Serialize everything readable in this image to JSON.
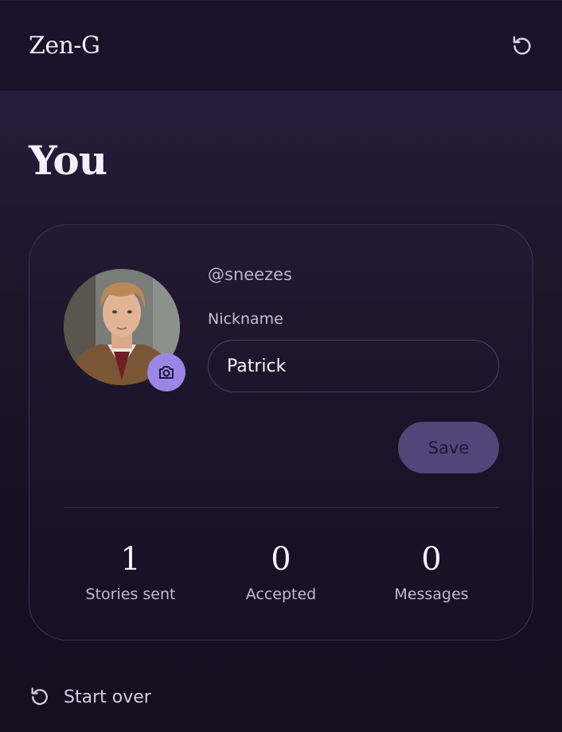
{
  "header": {
    "brand": "Zen-G",
    "refresh_icon": "refresh-icon"
  },
  "page": {
    "title": "You"
  },
  "profile": {
    "avatar_alt": "avatar",
    "camera_icon": "camera-icon",
    "handle": "@sneezes",
    "nickname_label": "Nickname",
    "nickname_value": "Patrick",
    "save_label": "Save"
  },
  "stats": [
    {
      "value": "1",
      "label": "Stories sent"
    },
    {
      "value": "0",
      "label": "Accepted"
    },
    {
      "value": "0",
      "label": "Messages"
    }
  ],
  "footer": {
    "start_over_label": "Start over",
    "start_over_icon": "restart-icon"
  },
  "colors": {
    "accent": "#9b86e6",
    "save_button": "#51457a",
    "background_top": "#2f2146",
    "background_bottom": "#141020"
  }
}
